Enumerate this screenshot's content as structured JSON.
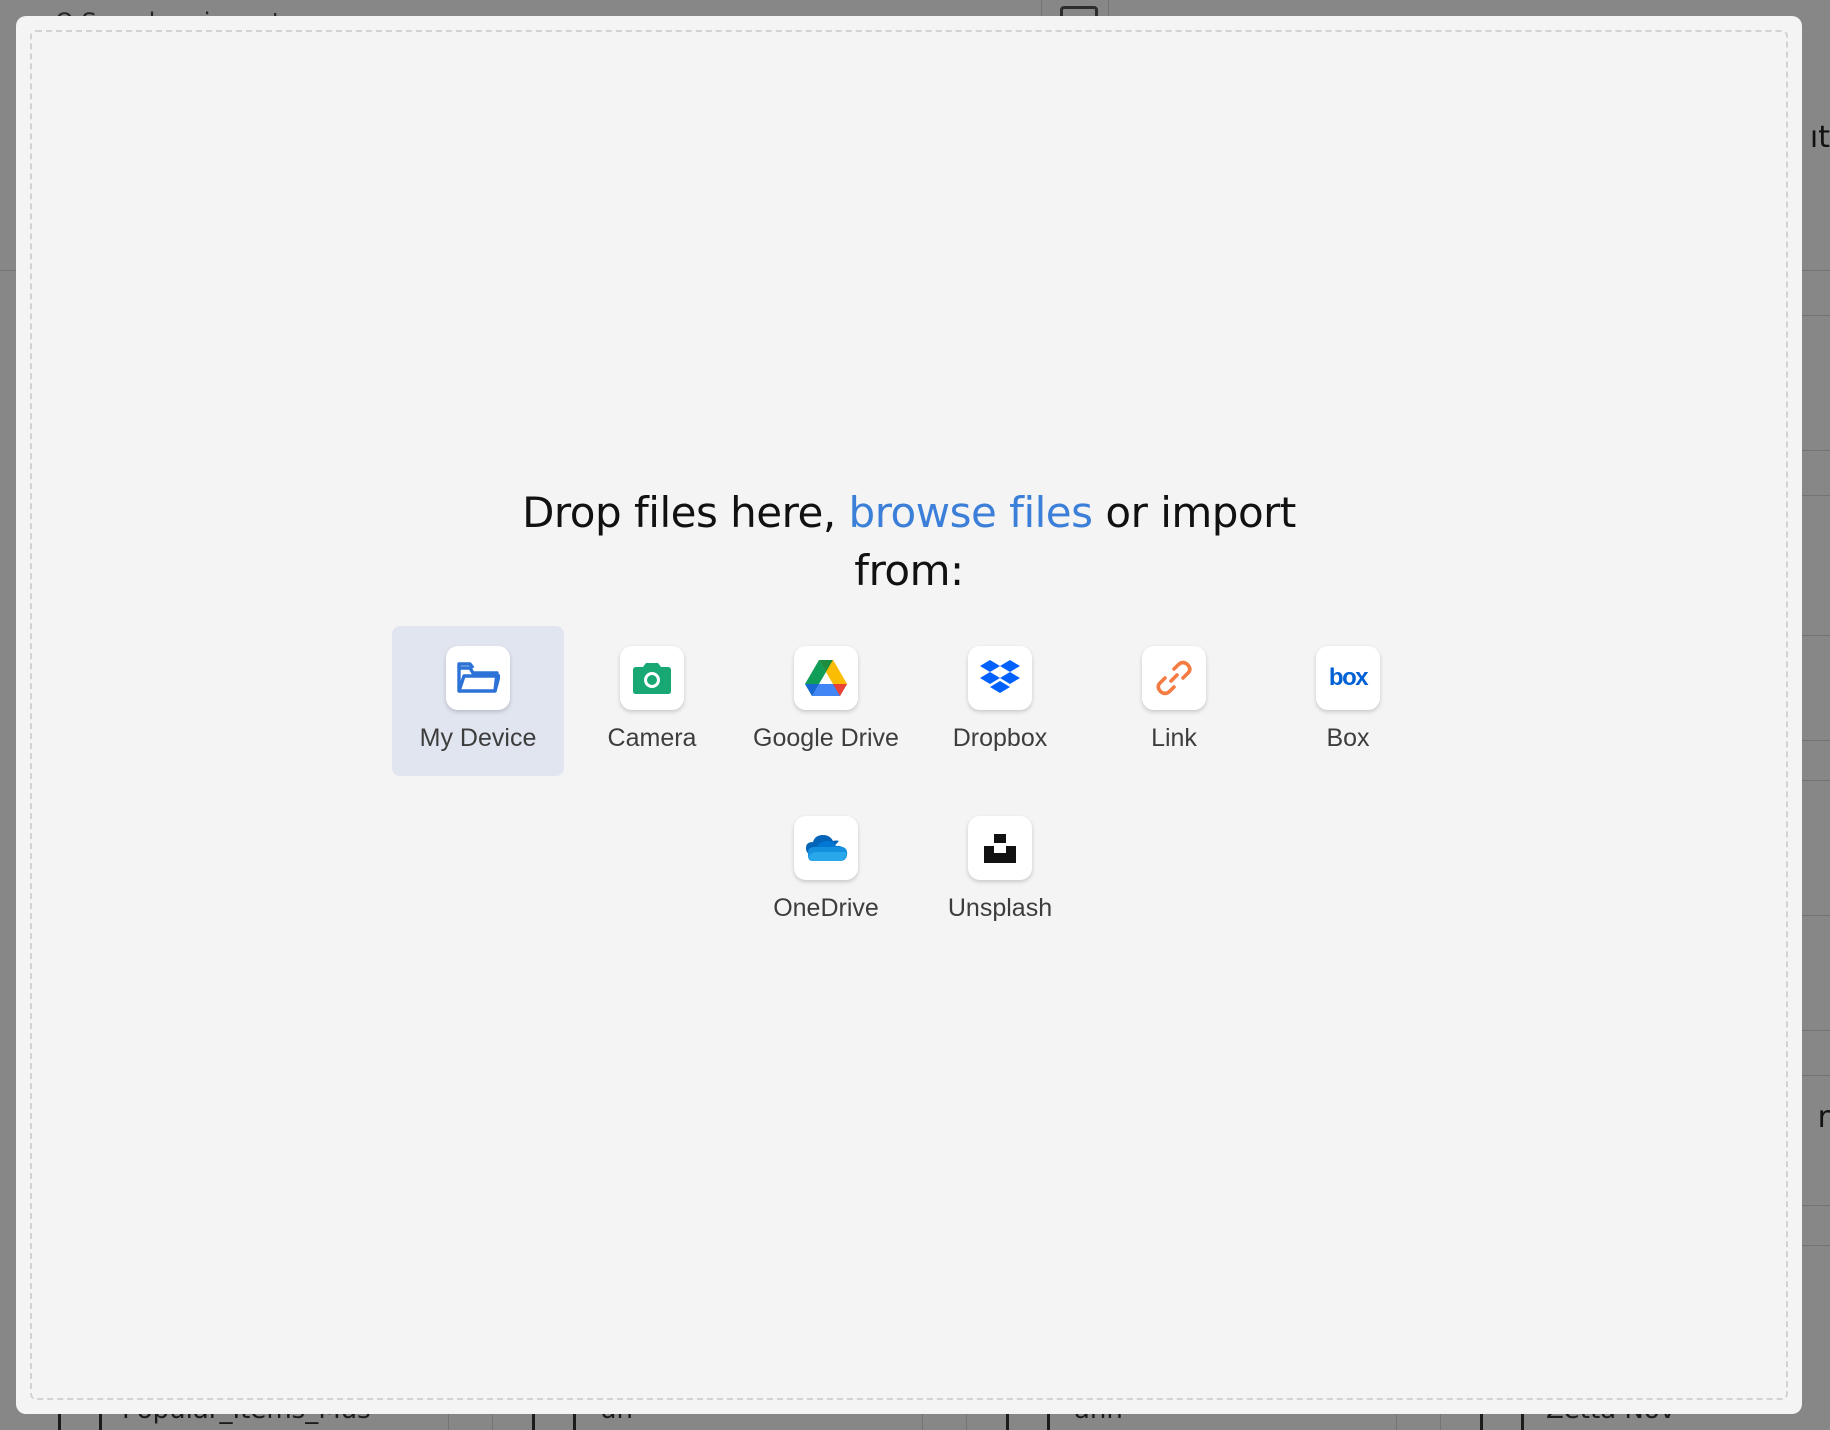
{
  "background": {
    "search_placeholder": "Q  Search or jump to...",
    "right_fragment_1": "ıt",
    "right_fragment_2": "r",
    "bottom_labels": [
      "Popular_Items_Mus",
      "un",
      "ann",
      "Zetta Nov"
    ]
  },
  "modal": {
    "title_prefix": "Drop files here,",
    "browse_link": "browse files",
    "title_suffix": "or import from:",
    "providers": [
      {
        "label": "My Device",
        "icon": "folder-icon",
        "selected": true
      },
      {
        "label": "Camera",
        "icon": "camera-icon",
        "selected": false
      },
      {
        "label": "Google Drive",
        "icon": "google-drive-icon",
        "selected": false
      },
      {
        "label": "Dropbox",
        "icon": "dropbox-icon",
        "selected": false
      },
      {
        "label": "Link",
        "icon": "link-icon",
        "selected": false
      },
      {
        "label": "Box",
        "icon": "box-icon",
        "selected": false
      },
      {
        "label": "OneDrive",
        "icon": "onedrive-icon",
        "selected": false
      },
      {
        "label": "Unsplash",
        "icon": "unsplash-icon",
        "selected": false
      }
    ],
    "box_logo_text": "box"
  },
  "colors": {
    "accent": "#3b7fd9",
    "camera": "#18a874",
    "link": "#f47c42",
    "dropbox": "#0061fe",
    "box": "#0061d5"
  }
}
